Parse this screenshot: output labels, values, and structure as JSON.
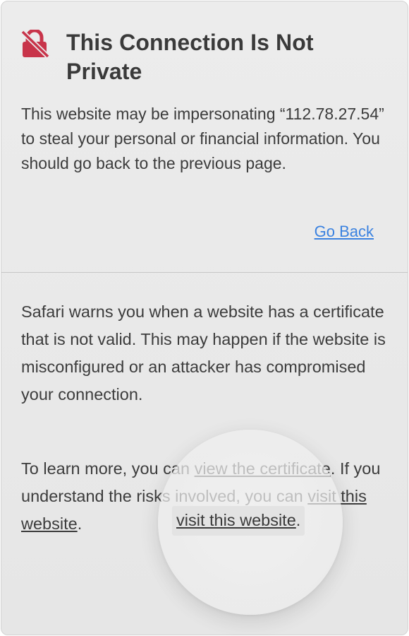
{
  "warning": {
    "title": "This Connection Is Not Private",
    "message": "This website may be impersonating “112.78.27.54” to steal your personal or financial information. You should go back to the previous page.",
    "go_back_label": "Go Back",
    "icon": "lock-slash-icon",
    "icon_color": "#c8344a"
  },
  "details": {
    "explanation": "Safari warns you when a website has a certificate that is not valid. This may happen if the website is misconfigured or an attacker has compromised your connection.",
    "learn_more_prefix": "To learn more, you can ",
    "view_certificate_link": "view the certificate",
    "learn_more_middle": ". If you understand the risks involved, you can ",
    "visit_website_link": "visit this website",
    "learn_more_suffix": "."
  },
  "colors": {
    "link_blue": "#3b82e0",
    "text": "#3c3c3c",
    "background": "#ebebeb"
  }
}
